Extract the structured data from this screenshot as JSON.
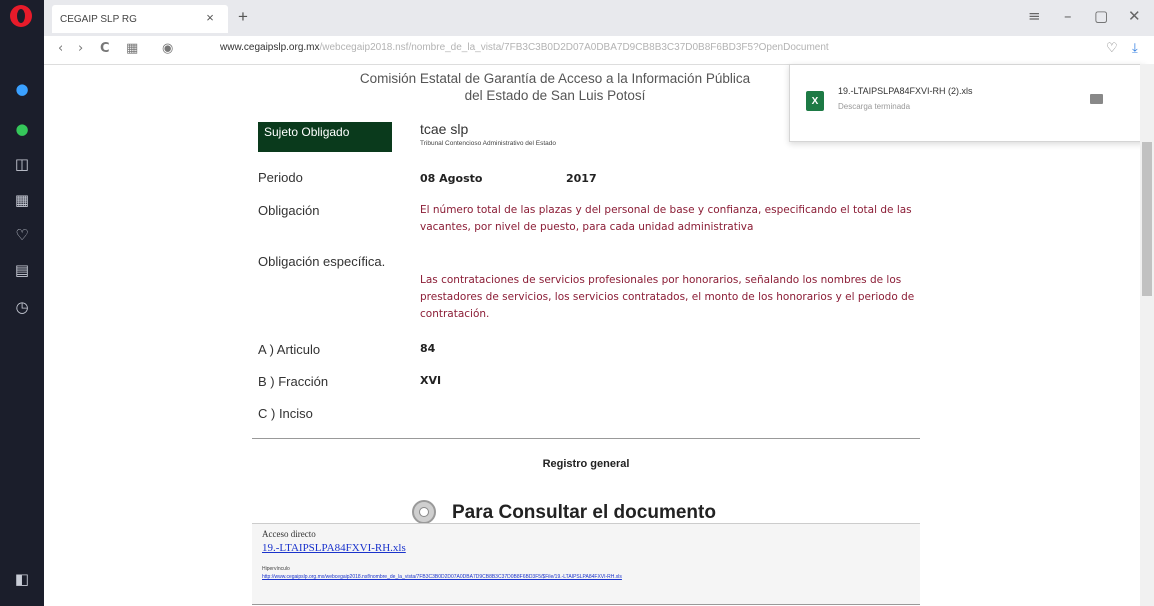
{
  "browser": {
    "tab_title": "CEGAIP SLP RG",
    "tab_close": "×",
    "new_tab": "+",
    "url_host": "www.cegaipslp.org.mx",
    "url_rest": "/webcegaip2018.nsf/nombre_de_la_vista/7FB3C3B0D2D07A0DBA7D9CB8B3C37D0B8F6BD3F5?OpenDocument",
    "window_controls": {
      "menu": "≡",
      "minimize": "–",
      "restore": "▢",
      "close": "✕"
    },
    "nav": {
      "back": "‹",
      "forward": "›",
      "reload": "C",
      "grid": "▦",
      "camera": "◉"
    }
  },
  "sidebar": {
    "icons": [
      "messenger-icon",
      "whatsapp-icon",
      "camera-icon",
      "grid-icon",
      "heart-icon",
      "news-icon",
      "history-icon"
    ],
    "glyphs": [
      "●",
      "●",
      "◫",
      "▦",
      "♡",
      "▤",
      "◷"
    ],
    "bottom_glyph": "◧"
  },
  "download": {
    "file_name": "19.-LTAIPSLPA84FXVI-RH (2).xls",
    "status": "Descarga terminada",
    "icon_letter": "X"
  },
  "header": {
    "line1": "Comisión Estatal de Garantía de Acceso a la Información Pública",
    "line2": "del Estado de San Luis Potosí"
  },
  "record": {
    "sujeto_label": "Sujeto Obligado",
    "sujeto_value": "tcae slp",
    "sujeto_sub": "Tribunal Contencioso Administrativo del Estado",
    "periodo_label": "Periodo",
    "periodo_month": "08 Agosto",
    "periodo_year": "2017",
    "obligacion_label": "Obligación",
    "obligacion_text": "El número total de las plazas y del personal de base y confianza, especificando el total de las vacantes, por nivel de puesto, para cada unidad administrativa",
    "obligacion_esp_label": "Obligación específica.",
    "obligacion_esp_text": "Las contrataciones de servicios profesionales por honorarios, señalando los nombres de los prestadores de servicios, los servicios contratados, el monto de los honorarios y el periodo de contratación.",
    "articulo_label": "A ) Articulo",
    "articulo_value": "84",
    "fraccion_label": "B ) Fracción",
    "fraccion_value": "XVI",
    "inciso_label": "C ) Inciso"
  },
  "registro": "Registro general",
  "consult": "Para Consultar el documento",
  "access": {
    "label": "Acceso directo",
    "link": "19.-LTAIPSLPA84FXVI-RH.xls",
    "hv_label": "Hipervínculo",
    "hv_link": "http://www.cegaipslp.org.mx/webcegaip2018.nsf/nombre_de_la_vista/7FB3C3B0D2D07A0DBA7D9CB8B3C37D0B8F6BD3F5/$File/19.-LTAIPSLPA84FXVI-RH.xls"
  }
}
